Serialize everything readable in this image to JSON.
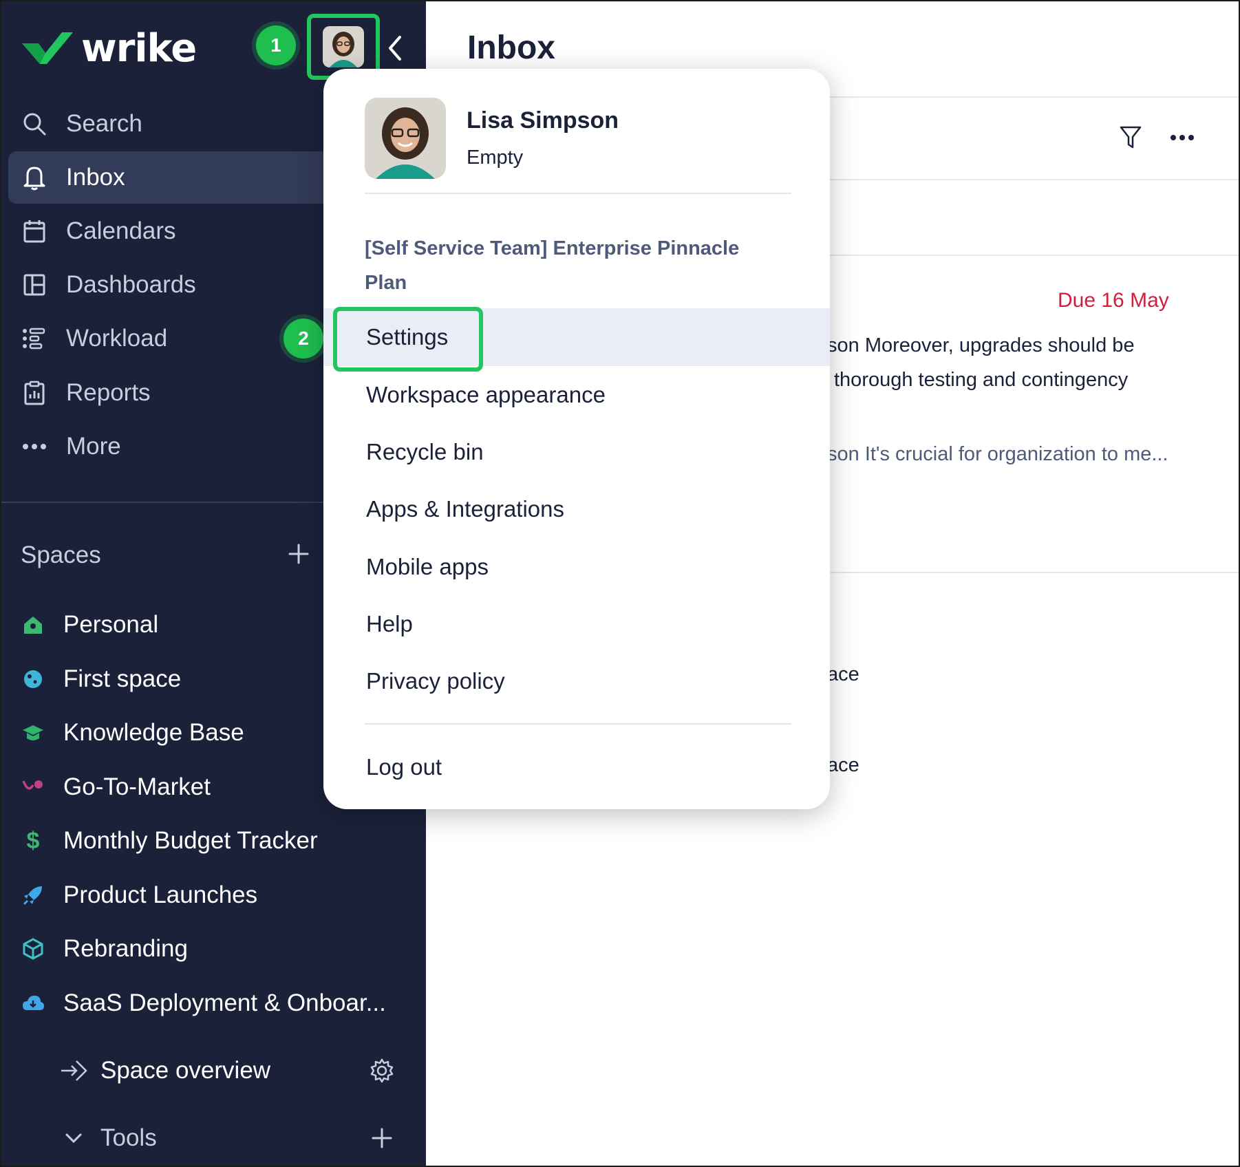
{
  "sidebar": {
    "brand": "wrike",
    "nav": [
      {
        "label": "Search",
        "icon": "search-icon"
      },
      {
        "label": "Inbox",
        "icon": "bell-icon",
        "active": true
      },
      {
        "label": "Calendars",
        "icon": "calendar-icon"
      },
      {
        "label": "Dashboards",
        "icon": "dashboard-icon"
      },
      {
        "label": "Workload",
        "icon": "workload-icon"
      },
      {
        "label": "Reports",
        "icon": "reports-icon"
      },
      {
        "label": "More",
        "icon": "more-dots-icon"
      }
    ],
    "spaces_label": "Spaces",
    "spaces": [
      {
        "label": "Personal",
        "icon": "home-icon",
        "color": "#3db872"
      },
      {
        "label": "First space",
        "icon": "planet-icon",
        "color": "#3fb6d9"
      },
      {
        "label": "Knowledge Base",
        "icon": "graduation-cap-icon",
        "color": "#2fb56a"
      },
      {
        "label": "Go-To-Market",
        "icon": "branch-icon",
        "color": "#c0418a"
      },
      {
        "label": "Monthly Budget Tracker",
        "icon": "dollar-icon",
        "color": "#3db872"
      },
      {
        "label": "Product Launches",
        "icon": "rocket-icon",
        "color": "#3fa8e8"
      },
      {
        "label": "Rebranding",
        "icon": "cube-icon",
        "color": "#3fc0c8"
      },
      {
        "label": "SaaS Deployment & Onboar...",
        "icon": "cloud-download-icon",
        "color": "#3fa8e8"
      }
    ],
    "space_overview": "Space overview",
    "tools": "Tools"
  },
  "badges": {
    "step1": "1",
    "step2": "2"
  },
  "main": {
    "title": "Inbox",
    "due": "Due 16 May",
    "fragments": {
      "line1": "son Moreover, upgrades should be",
      "line2": "thorough testing and contingency",
      "line3": "son It's crucial for organization to me...",
      "line4": "ace",
      "line5": "ace"
    }
  },
  "dropdown": {
    "name": "Lisa Simpson",
    "status": "Empty",
    "plan": "[Self Service Team] Enterprise Pinnacle Plan",
    "items": [
      "Settings",
      "Workspace appearance",
      "Recycle bin",
      "Apps & Integrations",
      "Mobile apps",
      "Help",
      "Privacy policy"
    ],
    "logout": "Log out"
  },
  "colors": {
    "sidebar_bg": "#1a2139",
    "active_bg": "#323b58",
    "highlight": "#22c55e",
    "due": "#d11f3b"
  }
}
